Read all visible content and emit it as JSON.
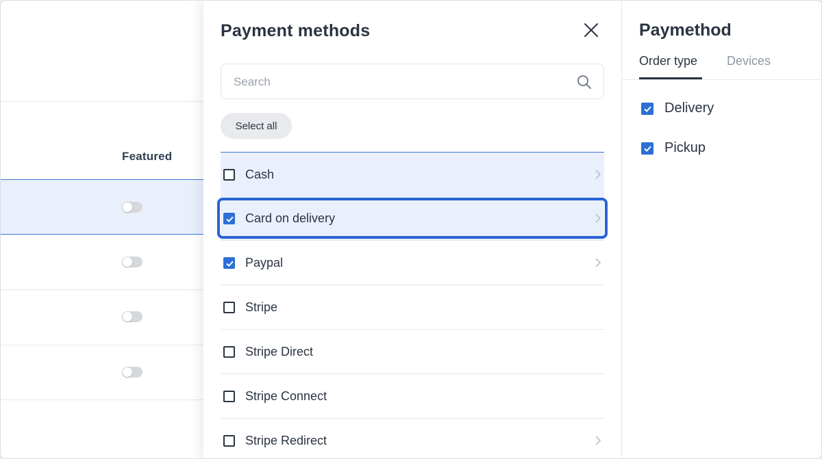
{
  "table": {
    "column_header": "Featured",
    "rows": [
      {
        "featured": false,
        "active": true
      },
      {
        "featured": false,
        "active": false
      },
      {
        "featured": false,
        "active": false
      },
      {
        "featured": false,
        "active": false
      }
    ]
  },
  "payment_panel": {
    "title": "Payment methods",
    "search_placeholder": "Search",
    "select_all_label": "Select all",
    "items": [
      {
        "label": "Cash",
        "checked": false,
        "has_chevron": true
      },
      {
        "label": "Card on delivery",
        "checked": true,
        "has_chevron": true
      },
      {
        "label": "Paypal",
        "checked": true,
        "has_chevron": true
      },
      {
        "label": "Stripe",
        "checked": false,
        "has_chevron": false
      },
      {
        "label": "Stripe Direct",
        "checked": false,
        "has_chevron": false
      },
      {
        "label": "Stripe Connect",
        "checked": false,
        "has_chevron": false
      },
      {
        "label": "Stripe Redirect",
        "checked": false,
        "has_chevron": true
      }
    ]
  },
  "detail_panel": {
    "title": "Paymethod",
    "tabs": [
      {
        "label": "Order type",
        "active": true
      },
      {
        "label": "Devices",
        "active": false
      }
    ],
    "options": [
      {
        "label": "Delivery",
        "checked": true
      },
      {
        "label": "Pickup",
        "checked": true
      }
    ]
  },
  "colors": {
    "accent": "#2d6fd6",
    "focus_ring": "#2a63d4",
    "highlight_bg": "#eaf0fb",
    "text": "#2b3442"
  },
  "icons": [
    "close-icon",
    "search-icon",
    "checkmark-icon",
    "chevron-right-icon"
  ]
}
